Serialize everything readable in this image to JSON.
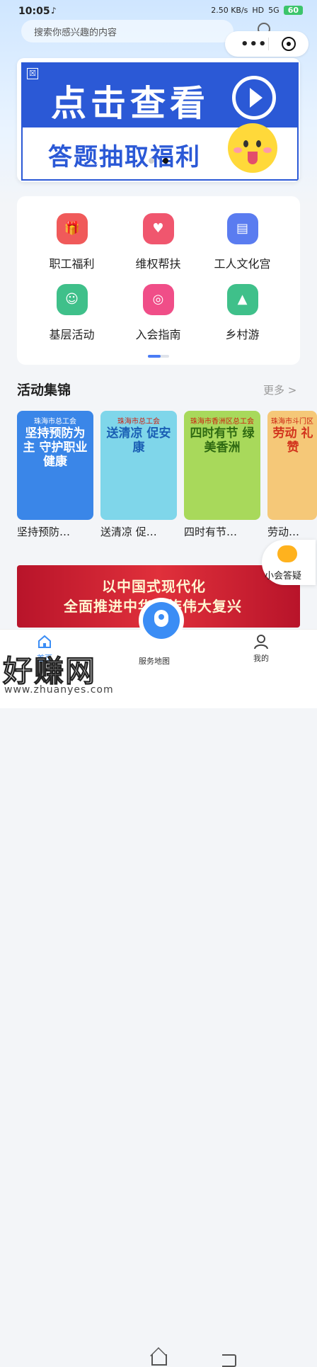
{
  "status_bar": {
    "time": "10:05",
    "notif": "♪",
    "speed": "2.50 KB/s",
    "hd": "HD",
    "net": "5G",
    "battery": "60"
  },
  "search": {
    "placeholder": "搜索你感兴趣的内容"
  },
  "capsule": {
    "more": "•••"
  },
  "banner": {
    "close": "☒",
    "title": "点击查看",
    "subtitle": "答题抽取福利"
  },
  "grid": [
    {
      "label": "职工福利",
      "icon": "gift-icon",
      "color": "#f05a5a",
      "glyph": "🎁"
    },
    {
      "label": "维权帮扶",
      "icon": "heart-hand-icon",
      "color": "#f0566e",
      "glyph": "♥"
    },
    {
      "label": "工人文化宫",
      "icon": "building-icon",
      "color": "#5a7cf0",
      "glyph": "▤"
    },
    {
      "label": "基层活动",
      "icon": "people-icon",
      "color": "#3fc08a",
      "glyph": "☺"
    },
    {
      "label": "入会指南",
      "icon": "union-badge-icon",
      "color": "#f04e88",
      "glyph": "◎"
    },
    {
      "label": "乡村游",
      "icon": "mountain-icon",
      "color": "#3fc08a",
      "glyph": "▲"
    }
  ],
  "section": {
    "title": "活动集锦",
    "more": "更多 >"
  },
  "cards": [
    {
      "caption": "坚持预防…",
      "header": "珠海市总工会",
      "headline": "坚持预防为主 守护职业健康",
      "color": "#3a86e8",
      "text_color": "#fff"
    },
    {
      "caption": "送清凉 促…",
      "header": "珠海市总工会",
      "headline": "送清凉 促安康",
      "color": "#7fd6ea",
      "text_color": "#1a5fb4"
    },
    {
      "caption": "四时有节…",
      "header": "珠海市香洲区总工会",
      "headline": "四时有节 绿美香洲",
      "color": "#a8d95b",
      "text_color": "#2f6a12"
    },
    {
      "caption": "劳动…",
      "header": "珠海市斗门区",
      "headline": "劳动 礼赞",
      "color": "#f5c878",
      "text_color": "#d2341d"
    }
  ],
  "float_button": {
    "label": "小会答疑"
  },
  "promo": {
    "line1": "以中国式现代化",
    "line2": "全面推进中华民族伟大复兴"
  },
  "tabbar": {
    "home": "首页",
    "map": "服务地图",
    "mine": "我的"
  },
  "watermark": {
    "text": "好赚网",
    "url": "www.zhuanyes.com"
  }
}
